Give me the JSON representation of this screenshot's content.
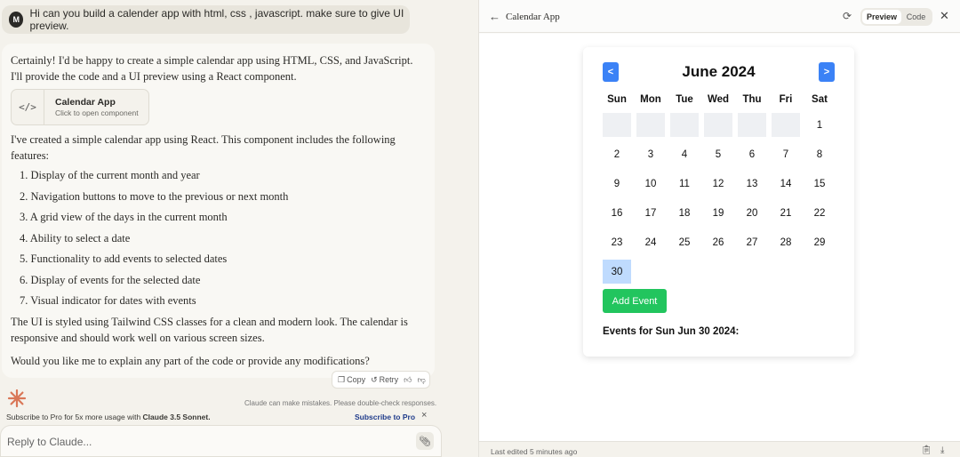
{
  "user_message": {
    "avatar": "M",
    "text": "Hi can you build a calender app with html, css , javascript. make sure to give UI preview."
  },
  "reply": {
    "intro": "Certainly! I'd be happy to create a simple calendar app using HTML, CSS, and JavaScript. I'll provide the code and a UI preview using a React component.",
    "artifact": {
      "title": "Calendar App",
      "subtitle": "Click to open component",
      "icon": "code-icon"
    },
    "para2": "I've created a simple calendar app using React. This component includes the following features:",
    "features": [
      "1. Display of the current month and year",
      "2. Navigation buttons to move to the previous or next month",
      "3. A grid view of the days in the current month",
      "4. Ability to select a date",
      "5. Functionality to add events to selected dates",
      "6. Display of events for the selected date",
      "7. Visual indicator for dates with events"
    ],
    "para3": "The UI is styled using Tailwind CSS classes for a clean and modern look. The calendar is responsive and should work well on various screen sizes.",
    "para4": "Would you like me to explain any part of the code or provide any modifications?",
    "actions": {
      "copy": "Copy",
      "retry": "Retry"
    }
  },
  "disclaimer": "Claude can make mistakes. Please double-check responses.",
  "subscribe": {
    "text_pre": "Subscribe to Pro for 5x more usage with ",
    "text_bold": "Claude 3.5 Sonnet.",
    "link": "Subscribe to Pro"
  },
  "input": {
    "placeholder": "Reply to Claude..."
  },
  "artifact_panel": {
    "title": "Calendar App",
    "preview_label": "Preview",
    "code_label": "Code",
    "footer": "Last edited 5 minutes ago"
  },
  "calendar": {
    "prev": "<",
    "next": ">",
    "month_title": "June 2024",
    "weekdays": [
      "Sun",
      "Mon",
      "Tue",
      "Wed",
      "Thu",
      "Fri",
      "Sat"
    ],
    "leading_blanks": 6,
    "days": [
      "1",
      "2",
      "3",
      "4",
      "5",
      "6",
      "7",
      "8",
      "9",
      "10",
      "11",
      "12",
      "13",
      "14",
      "15",
      "16",
      "17",
      "18",
      "19",
      "20",
      "21",
      "22",
      "23",
      "24",
      "25",
      "26",
      "27",
      "28",
      "29",
      "30"
    ],
    "selected_day": "30",
    "add_event_label": "Add Event",
    "events_label": "Events for Sun Jun 30 2024:"
  },
  "colors": {
    "nav_blue": "#3b82f6",
    "selected": "#bfdbfe",
    "add_green": "#22c55e",
    "accent_orange": "#d97757"
  }
}
